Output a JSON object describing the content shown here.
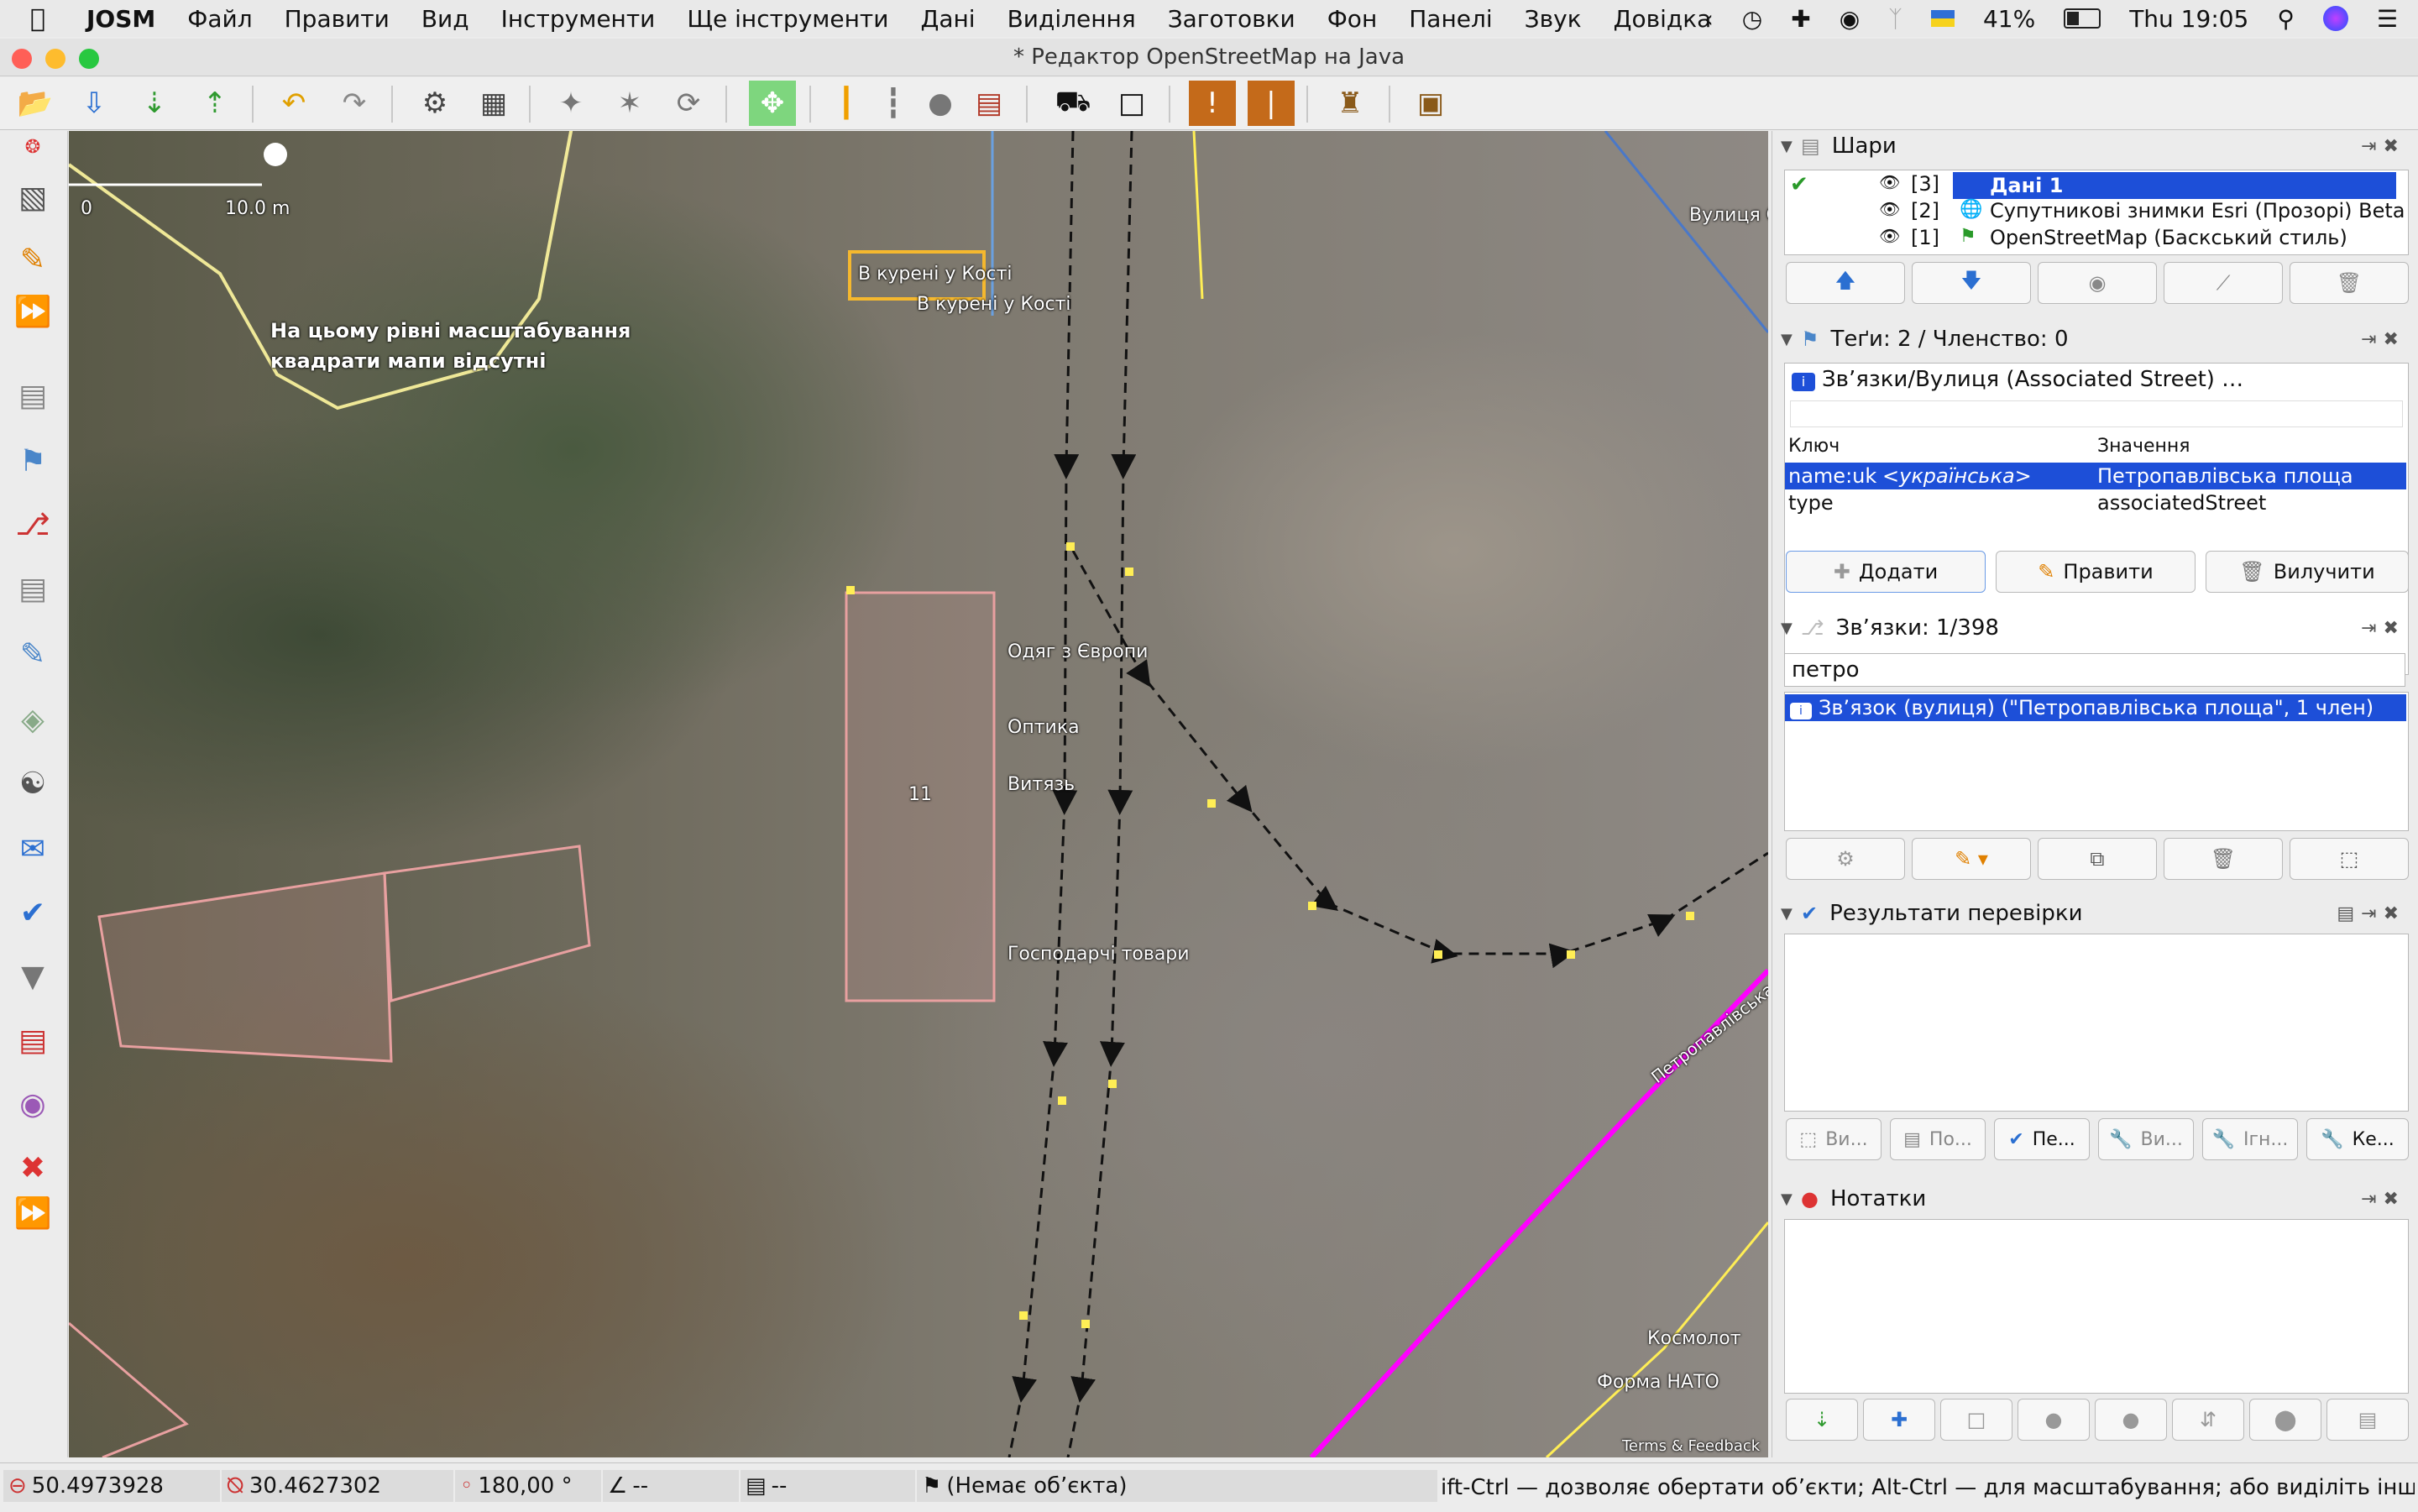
{
  "menubar": {
    "apple": "",
    "app": "JOSM",
    "items": [
      "Файл",
      "Правити",
      "Вид",
      "Інструменти",
      "Ще інструменти",
      "Дані",
      "Виділення",
      "Заготовки",
      "Фон",
      "Панелі",
      "Звук",
      "Довідка"
    ],
    "battery": "41%",
    "clock": "Thu 19:05"
  },
  "window": {
    "title": "* Редактор OpenStreetMap на Java"
  },
  "map": {
    "scale_zero": "0",
    "scale_label": "10.0 m",
    "zoom_warning": "На цьому рівні масштабування квадрати мапи відсутні",
    "labels": {
      "kureni_box": "В курені у Кості",
      "kureni": "В курені у Кості",
      "odyag": "Одяг з Європи",
      "optyka": "Оптика",
      "vytiaz": "Витязь",
      "hospodarchi": "Господарчі товари",
      "building_number": "11",
      "vulytsia": "Вулиця С",
      "petropavlivska": "Петропавлівська",
      "kosmolot": "Космолот",
      "forma_nato": "Форма НАТО",
      "attribution": "Terms & Feedback"
    }
  },
  "layers_panel": {
    "title": "Шари",
    "layers": [
      {
        "index": "[3]",
        "name": "Дані 1"
      },
      {
        "index": "[2]",
        "name": "Супутникові знимки Esri (Прозорі) Beta"
      },
      {
        "index": "[1]",
        "name": "OpenStreetMap (Баскський стиль)"
      }
    ]
  },
  "tags_panel": {
    "title": "Теґи: 2 / Членство: 0",
    "selection": "Зв’язки/Вулиця (Associated Street) …",
    "col_key": "Ключ",
    "col_value": "Значення",
    "rows": [
      {
        "key": "name:uk",
        "key_hint": "<українська>",
        "value": "Петропавлівська площа"
      },
      {
        "key": "type",
        "key_hint": "",
        "value": "associatedStreet"
      }
    ],
    "add": "Додати",
    "edit": "Правити",
    "delete": "Вилучити"
  },
  "relations_panel": {
    "title": "Зв’язки: 1/398",
    "filter": "петро",
    "items": [
      "Зв’язок (вулиця) (\"Петропавлівська площа\", 1 член)"
    ]
  },
  "validation_panel": {
    "title": "Результати перевірки",
    "buttons": [
      "Ви...",
      "По...",
      "Пе...",
      "Ви...",
      "Ігн...",
      "Ке..."
    ]
  },
  "notes_panel": {
    "title": "Нотатки"
  },
  "status": {
    "lat": "50.4973928",
    "lon": "30.4627302",
    "heading": "180,00 °",
    "angle": "--",
    "distance": "--",
    "object": "(Немає об’єкта)",
    "hint": "ift-Ctrl — дозволяє обертати об’єкти; Alt-Ctrl — для масштабування; або виділіть інше"
  },
  "colors": {
    "selection": "#1d4fd8",
    "way_yellow": "#ffee55",
    "magenta": "#ff00ff",
    "building": "#e8a0a0"
  }
}
